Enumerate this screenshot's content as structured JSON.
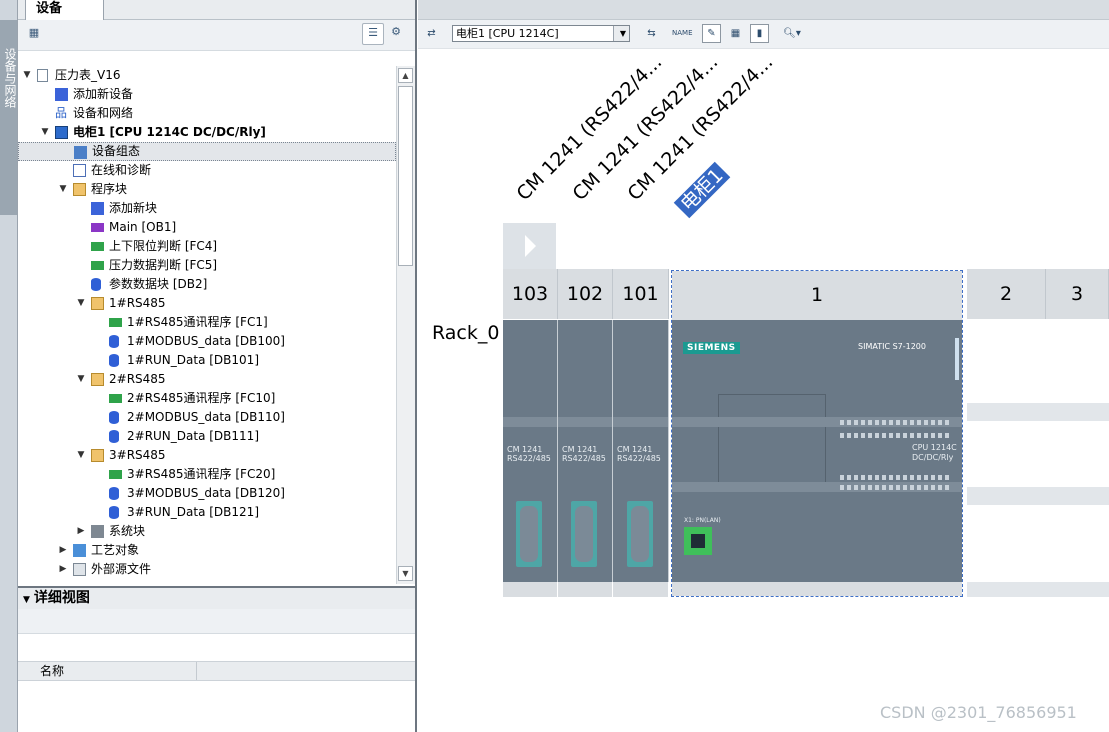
{
  "side_tab": {
    "label": "设备与网络"
  },
  "left_panel": {
    "tab_title": "设备",
    "tree": [
      {
        "label": "压力表_V16",
        "level": 0,
        "expand": "▼",
        "icon": "project-icon",
        "icls": "page"
      },
      {
        "label": "添加新设备",
        "level": 1,
        "expand": "",
        "icon": "add-device-icon",
        "icls": "add"
      },
      {
        "label": "设备和网络",
        "level": 1,
        "expand": "",
        "icon": "network-icon",
        "icls": "net"
      },
      {
        "label": "电柜1 [CPU 1214C DC/DC/Rly]",
        "level": 1,
        "expand": "▼",
        "icon": "plc-icon",
        "icls": "plc",
        "bold": true
      },
      {
        "label": "设备组态",
        "level": 2,
        "expand": "",
        "icon": "device-config-icon",
        "icls": "cfg",
        "selected": true
      },
      {
        "label": "在线和诊断",
        "level": 2,
        "expand": "",
        "icon": "diagnostics-icon",
        "icls": "diag"
      },
      {
        "label": "程序块",
        "level": 2,
        "expand": "▼",
        "icon": "folder-icon",
        "icls": "folder"
      },
      {
        "label": "添加新块",
        "level": 3,
        "expand": "",
        "icon": "add-block-icon",
        "icls": "add"
      },
      {
        "label": "Main [OB1]",
        "level": 3,
        "expand": "",
        "icon": "ob-block-icon",
        "icls": "ob"
      },
      {
        "label": "上下限位判断 [FC4]",
        "level": 3,
        "expand": "",
        "icon": "fc-block-icon",
        "icls": "fc"
      },
      {
        "label": "压力数据判断 [FC5]",
        "level": 3,
        "expand": "",
        "icon": "fc-block-icon",
        "icls": "fc"
      },
      {
        "label": "参数数据块 [DB2]",
        "level": 3,
        "expand": "",
        "icon": "db-block-icon",
        "icls": "db"
      },
      {
        "label": "1#RS485",
        "level": 3,
        "expand": "▼",
        "icon": "folder-icon",
        "icls": "folder"
      },
      {
        "label": "1#RS485通讯程序 [FC1]",
        "level": 4,
        "expand": "",
        "icon": "fc-block-icon",
        "icls": "fc"
      },
      {
        "label": "1#MODBUS_data [DB100]",
        "level": 4,
        "expand": "",
        "icon": "db-block-icon",
        "icls": "db"
      },
      {
        "label": "1#RUN_Data [DB101]",
        "level": 4,
        "expand": "",
        "icon": "db-block-icon",
        "icls": "db"
      },
      {
        "label": "2#RS485",
        "level": 3,
        "expand": "▼",
        "icon": "folder-icon",
        "icls": "folder"
      },
      {
        "label": "2#RS485通讯程序 [FC10]",
        "level": 4,
        "expand": "",
        "icon": "fc-block-icon",
        "icls": "fc"
      },
      {
        "label": "2#MODBUS_data [DB110]",
        "level": 4,
        "expand": "",
        "icon": "db-block-icon",
        "icls": "db"
      },
      {
        "label": "2#RUN_Data [DB111]",
        "level": 4,
        "expand": "",
        "icon": "db-block-icon",
        "icls": "db"
      },
      {
        "label": "3#RS485",
        "level": 3,
        "expand": "▼",
        "icon": "folder-icon",
        "icls": "folder"
      },
      {
        "label": "3#RS485通讯程序 [FC20]",
        "level": 4,
        "expand": "",
        "icon": "fc-block-icon",
        "icls": "fc"
      },
      {
        "label": "3#MODBUS_data [DB120]",
        "level": 4,
        "expand": "",
        "icon": "db-block-icon",
        "icls": "db"
      },
      {
        "label": "3#RUN_Data [DB121]",
        "level": 4,
        "expand": "",
        "icon": "db-block-icon",
        "icls": "db"
      },
      {
        "label": "系统块",
        "level": 3,
        "expand": "▶",
        "icon": "system-blocks-icon",
        "icls": "sys"
      },
      {
        "label": "工艺对象",
        "level": 2,
        "expand": "▶",
        "icon": "technology-objects-icon",
        "icls": "tech"
      },
      {
        "label": "外部源文件",
        "level": 2,
        "expand": "▶",
        "icon": "external-source-icon",
        "icls": "ext"
      }
    ]
  },
  "detail_view": {
    "title": "详细视图",
    "column_name": "名称"
  },
  "editor": {
    "device_select": "电柜1 [CPU 1214C]",
    "rotated_labels": [
      "CM 1241 (RS422/4...",
      "CM 1241 (RS422/4...",
      "CM 1241 (RS422/4..."
    ],
    "cpu_tag": "电柜1",
    "rack_name": "Rack_0",
    "slots": [
      "103",
      "102",
      "101",
      "1",
      "2",
      "3"
    ],
    "cm_module_text": "CM 1241\nRS422/485",
    "cpu_brand": "SIEMENS",
    "cpu_series": "SIMATIC S7-1200",
    "cpu_model": "CPU 1214C\nDC/DC/Rly",
    "cpu_port_label": "X1: PN(LAN)"
  },
  "watermark": "CSDN @2301_76856951",
  "colors": {
    "module_body": "#6a7987",
    "selection_blue": "#3467c3",
    "siemens_teal": "#1b9a91"
  }
}
